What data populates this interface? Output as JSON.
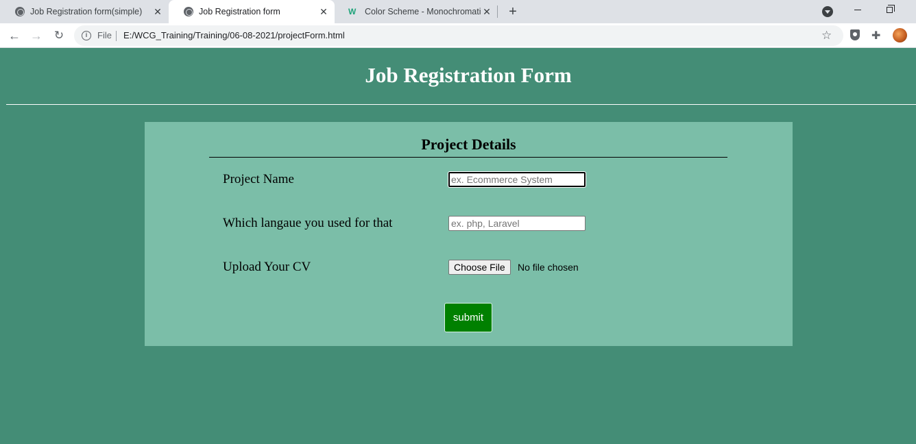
{
  "browser": {
    "tabs": [
      {
        "title": "Job Registration form(simple)",
        "icon": "globe-icon"
      },
      {
        "title": "Job Registration form",
        "icon": "globe-icon",
        "active": true
      },
      {
        "title": "Color Scheme - Monochromatic",
        "icon": "w-logo-icon"
      }
    ],
    "address": {
      "scheme_label": "File",
      "url": "E:/WCG_Training/Training/06-08-2021/projectForm.html"
    }
  },
  "page": {
    "title": "Job Registration Form",
    "section_title": "Project Details",
    "fields": {
      "project_name": {
        "label": "Project Name",
        "placeholder": "ex. Ecommerce System",
        "value": ""
      },
      "language": {
        "label": "Which langaue you used for that",
        "placeholder": "ex. php, Laravel",
        "value": ""
      },
      "cv": {
        "label": "Upload Your CV",
        "button_label": "Choose File",
        "status": "No file chosen"
      }
    },
    "submit_label": "submit"
  },
  "colors": {
    "page_background": "#448d76",
    "panel_background": "#7bbea8",
    "submit_background": "#008000"
  }
}
